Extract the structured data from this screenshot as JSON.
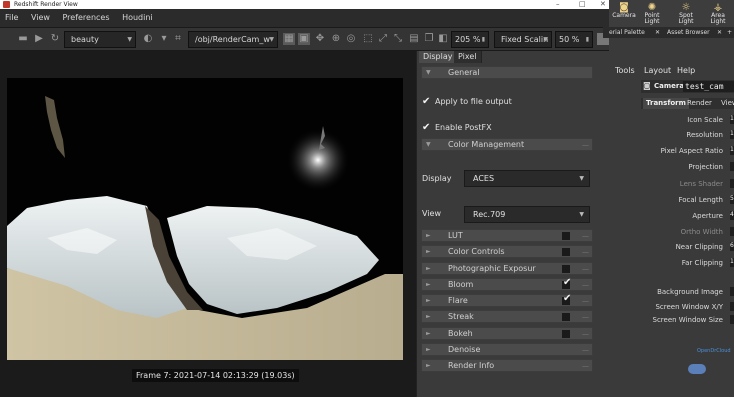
{
  "window": {
    "title": "Redshift Render View",
    "controls": [
      "–",
      "□",
      "✕"
    ]
  },
  "menu": [
    "File",
    "View",
    "Preferences",
    "Houdini"
  ],
  "toolbar": {
    "aov": "beauty",
    "camera_path": "/obj/RenderCam_w",
    "zoom": "205 %",
    "scaling_mode": "Fixed Scalin",
    "scaling_percent": "50 %"
  },
  "viewport": {
    "frame_caption": "Frame  7: 2021-07-14 02:13:29 (19.03s)"
  },
  "panel": {
    "tabs": [
      "Display",
      "Pixel"
    ],
    "general_label": "General",
    "apply_file_output": "Apply to file output",
    "enable_postfx": "Enable PostFX",
    "color_management": "Color Management",
    "display_label": "Display",
    "display_value": "ACES",
    "view_label": "View",
    "view_value": "Rec.709",
    "effects": [
      {
        "label": "LUT",
        "checked": false
      },
      {
        "label": "Color Controls",
        "checked": false
      },
      {
        "label": "Photographic Exposur",
        "checked": false
      },
      {
        "label": "Bloom",
        "checked": true
      },
      {
        "label": "Flare",
        "checked": true
      },
      {
        "label": "Streak",
        "checked": false
      },
      {
        "label": "Bokeh",
        "checked": false
      },
      {
        "label": "Denoise",
        "checked": null
      },
      {
        "label": "Render Info",
        "checked": null
      }
    ]
  },
  "houdini": {
    "shelf": [
      "Camera",
      "Point Light",
      "Spot Light",
      "Area Light"
    ],
    "pane_tabs": [
      "erial Palette",
      "Asset Browser"
    ],
    "menu": [
      "Tools",
      "Layout",
      "Help"
    ],
    "node_type": "Camera",
    "node_name": "test_cam",
    "param_tabs": [
      "Transform",
      "Render",
      "View"
    ],
    "params": [
      {
        "label": "Icon Scale",
        "dim": false
      },
      {
        "label": "Resolution",
        "dim": false
      },
      {
        "label": "Pixel Aspect Ratio",
        "dim": false
      },
      {
        "label": "Projection",
        "dim": false
      },
      {
        "label": "Lens Shader",
        "dim": true
      },
      {
        "label": "Focal Length",
        "dim": false
      },
      {
        "label": "Aperture",
        "dim": false
      },
      {
        "label": "Ortho Width",
        "dim": true
      },
      {
        "label": "Near Clipping",
        "dim": false
      },
      {
        "label": "Far Clipping",
        "dim": false
      },
      {
        "label": "Background Image",
        "dim": false
      },
      {
        "label": "Screen Window X/Y",
        "dim": false
      },
      {
        "label": "Screen Window Size",
        "dim": false
      }
    ],
    "param_values": [
      "1",
      "1",
      "1",
      "",
      "",
      "5",
      "4",
      "",
      "6",
      "1",
      "",
      "",
      ""
    ],
    "watermark": "OpenDrCloud"
  },
  "colors": {
    "check": "#f0f0f0",
    "section": "#4b4b4b",
    "panel": "#3a3a3a"
  }
}
